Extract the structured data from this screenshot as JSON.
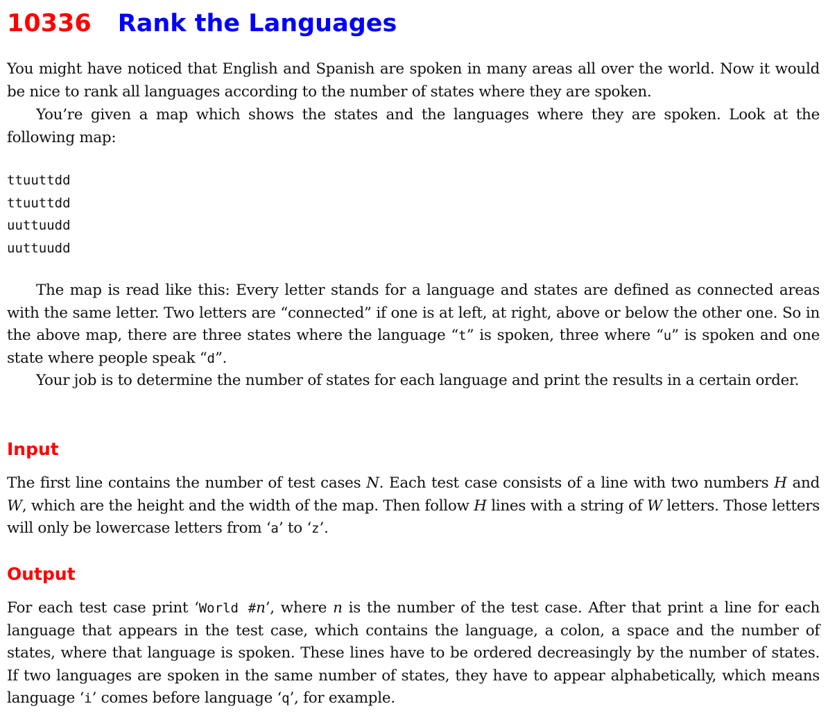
{
  "problem": {
    "number": "10336",
    "title": "Rank the Languages"
  },
  "intro": {
    "p1": "You might have noticed that English and Spanish are spoken in many areas all over the world. Now it would be nice to rank all languages according to the number of states where they are spoken.",
    "p2": "You’re given a map which shows the states and the languages where they are spoken. Look at the following map:",
    "map_lines": [
      "ttuuttdd",
      "ttuuttdd",
      "uuttuudd",
      "uuttuudd"
    ],
    "p3": {
      "t1": "The map is read like this: Every letter stands for a language and states are defined as connected areas with the same letter. Two letters are “connected” if one is at left, at right, above or below the other one. So in the above map, there are three states where the language “",
      "c1": "t",
      "t2": "” is spoken, three where “",
      "c2": "u",
      "t3": "” is spoken and one state where people speak “",
      "c3": "d",
      "t4": "”."
    },
    "p4": "Your job is to determine the number of states for each language and print the results in a certain order."
  },
  "input": {
    "heading": "Input",
    "t1": "The first line contains the number of test cases ",
    "v_n": "N",
    "t2": ". Each test case consists of a line with two numbers ",
    "v_h": "H",
    "t3": " and ",
    "v_w": "W",
    "t4": ", which are the height and the width of the map. Then follow ",
    "v_h2": "H",
    "t5": " lines with a string of ",
    "v_w2": "W",
    "t6": " letters. Those letters will only be lowercase letters from ‘",
    "c_a": "a",
    "t7": "’ to ‘",
    "c_z": "z",
    "t8": "’."
  },
  "output": {
    "heading": "Output",
    "t1": "For each test case print ‘",
    "c_world": "World #",
    "v_n": "n",
    "t2": "’, where ",
    "v_n2": "n",
    "t3": " is the number of the test case. After that print a line for each language that appears in the test case, which contains the language, a colon, a space and the number of states, where that language is spoken. These lines have to be ordered decreasingly by the number of states. If two languages are spoken in the same number of states, they have to appear alphabetically, which means language ‘",
    "c_i": "i",
    "t4": "’ comes before language ‘",
    "c_q": "q",
    "t5": "’, for example."
  }
}
